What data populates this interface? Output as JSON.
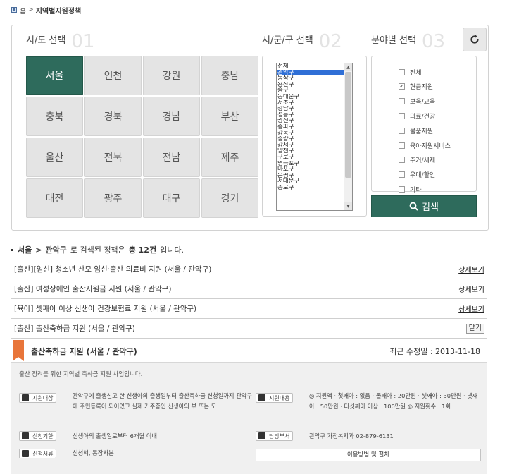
{
  "breadcrumb": {
    "home": "홈",
    "current": "지역별지원정책"
  },
  "step1": {
    "title": "시/도 선택",
    "num": "01"
  },
  "step2": {
    "title": "시/군/구 선택",
    "num": "02"
  },
  "step3": {
    "title": "분야별 선택",
    "num": "03"
  },
  "cities": [
    "서울",
    "인천",
    "강원",
    "충남",
    "충북",
    "경북",
    "경남",
    "부산",
    "울산",
    "전북",
    "전남",
    "제주",
    "대전",
    "광주",
    "대구",
    "경기"
  ],
  "selected_city": "서울",
  "districts": [
    "전체",
    "관악구",
    "동작구",
    "용산구",
    "중구",
    "동대문구",
    "서초구",
    "강남구",
    "성동구",
    "광진구",
    "송파구",
    "강동구",
    "중랑구",
    "강서구",
    "양천구",
    "구로구",
    "영등포구",
    "마포구",
    "은평구",
    "서대문구",
    "종로구"
  ],
  "selected_district": "관악구",
  "categories": [
    {
      "label": "전체",
      "checked": ""
    },
    {
      "label": "현금지원",
      "checked": "✓"
    },
    {
      "label": "보육/교육",
      "checked": ""
    },
    {
      "label": "의료/건강",
      "checked": ""
    },
    {
      "label": "물품지원",
      "checked": ""
    },
    {
      "label": "육아지원서비스",
      "checked": ""
    },
    {
      "label": "주거/세제",
      "checked": ""
    },
    {
      "label": "우대/할인",
      "checked": ""
    },
    {
      "label": "기타",
      "checked": ""
    }
  ],
  "search_label": "검색",
  "result": {
    "city": "서울",
    "district": "관악구",
    "text1": "로 검색된 정책은",
    "count": "총 12건",
    "text2": "입니다."
  },
  "policies": [
    {
      "title": "[출산][임신] 청소년 산모 임신·출산 의료비 지원 (서울 / 관악구)",
      "action": "상세보기"
    },
    {
      "title": "[출산] 여성장애인 출산지원금 지원 (서울 / 관악구)",
      "action": "상세보기"
    },
    {
      "title": "[육아] 셋째아 이상 신생아 건강보험료 지원 (서울 / 관악구)",
      "action": "상세보기"
    },
    {
      "title": "[출산] 출산축하금 지원 (서울 / 관악구)",
      "action": "닫기"
    }
  ],
  "detail": {
    "title": "출산축하금 지원 (서울 / 관악구)",
    "date_label": "최근 수정일 : 2013-11-18",
    "desc": "출산 장려를 위한 지역별 축하금 지원 사업입니다.",
    "target_label": "지원대상",
    "target_text": "관악구에 출생신고 한 신생아의 출생일부터 출산축하금 신청일까지 관악구에 주민등록이 되어있고 실제 거주중인 신생아의 부 또는 모",
    "content_label": "지원내용",
    "content_text": "◎ 지원액 · 첫째아 : 없음 · 둘째아 : 20만원 · 셋째아 : 30만원 · 넷째아 : 50만원 · 다섯째아 이상 : 100만원 ◎ 지원횟수 : 1회",
    "period_label": "신청기한",
    "period_text": "신생아의 출생일로부터 6개월 이내",
    "dept_label": "담당부서",
    "dept_text": "관악구 가정복지과 02-879-6131",
    "docs_label": "신청서류",
    "docs_text": "신청서, 통장사본",
    "guide_label": "이용방법 및 절차"
  }
}
